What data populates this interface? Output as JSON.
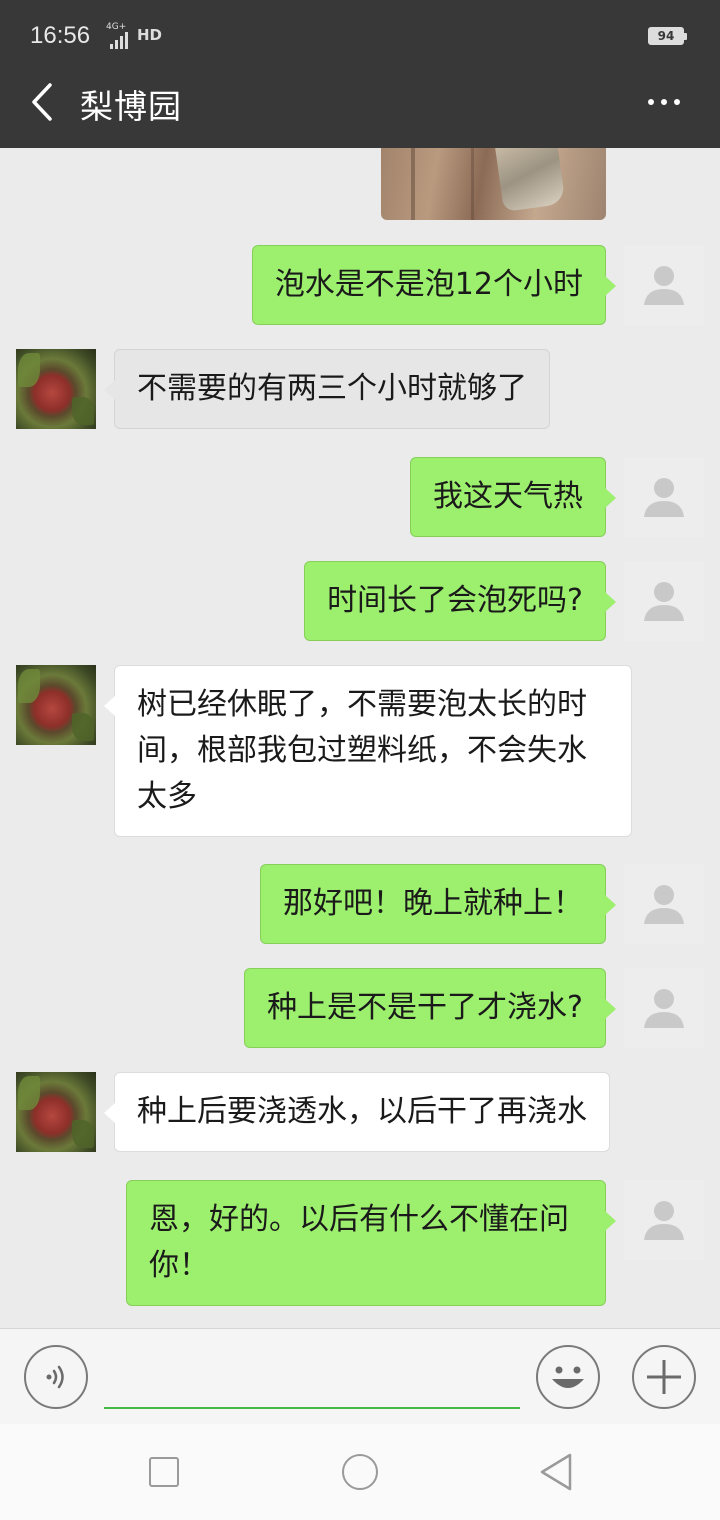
{
  "status_bar": {
    "time": "16:56",
    "network": "4G+",
    "hd": "HD",
    "battery": "94"
  },
  "header": {
    "title": "梨博园",
    "back_icon": "chevron-left-icon",
    "more_icon": "more-dots-icon"
  },
  "messages": [
    {
      "from": "me",
      "text": "泡水是不是泡12个小时"
    },
    {
      "from": "other",
      "text": "不需要的有两三个小时就够了"
    },
    {
      "from": "me",
      "text": "我这天气热"
    },
    {
      "from": "me",
      "text": "时间长了会泡死吗?"
    },
    {
      "from": "other",
      "lines": [
        "树已经休眠了，不需要泡太长的时",
        "间，根部我包过塑料纸，不会失水",
        "太多"
      ]
    },
    {
      "from": "me",
      "text": "那好吧！晚上就种上！"
    },
    {
      "from": "me",
      "text": "种上是不是干了才浇水?"
    },
    {
      "from": "other",
      "text": "种上后要浇透水，以后干了再浇水"
    },
    {
      "from": "me",
      "lines": [
        "恩，好的。以后有什么不懂在问",
        "你！"
      ]
    }
  ],
  "input_bar": {
    "voice_icon": "voice-icon",
    "input_value": "",
    "emoji_icon": "emoji-icon",
    "plus_icon": "plus-icon"
  },
  "nav_bar": {
    "recent_icon": "square-icon",
    "home_icon": "circle-icon",
    "back_icon": "triangle-back-icon"
  },
  "colors": {
    "header_bg": "#383838",
    "chat_bg": "#ebebeb",
    "my_bubble": "#9def6e",
    "other_bubble": "#ffffff",
    "input_underline": "#45b845"
  }
}
